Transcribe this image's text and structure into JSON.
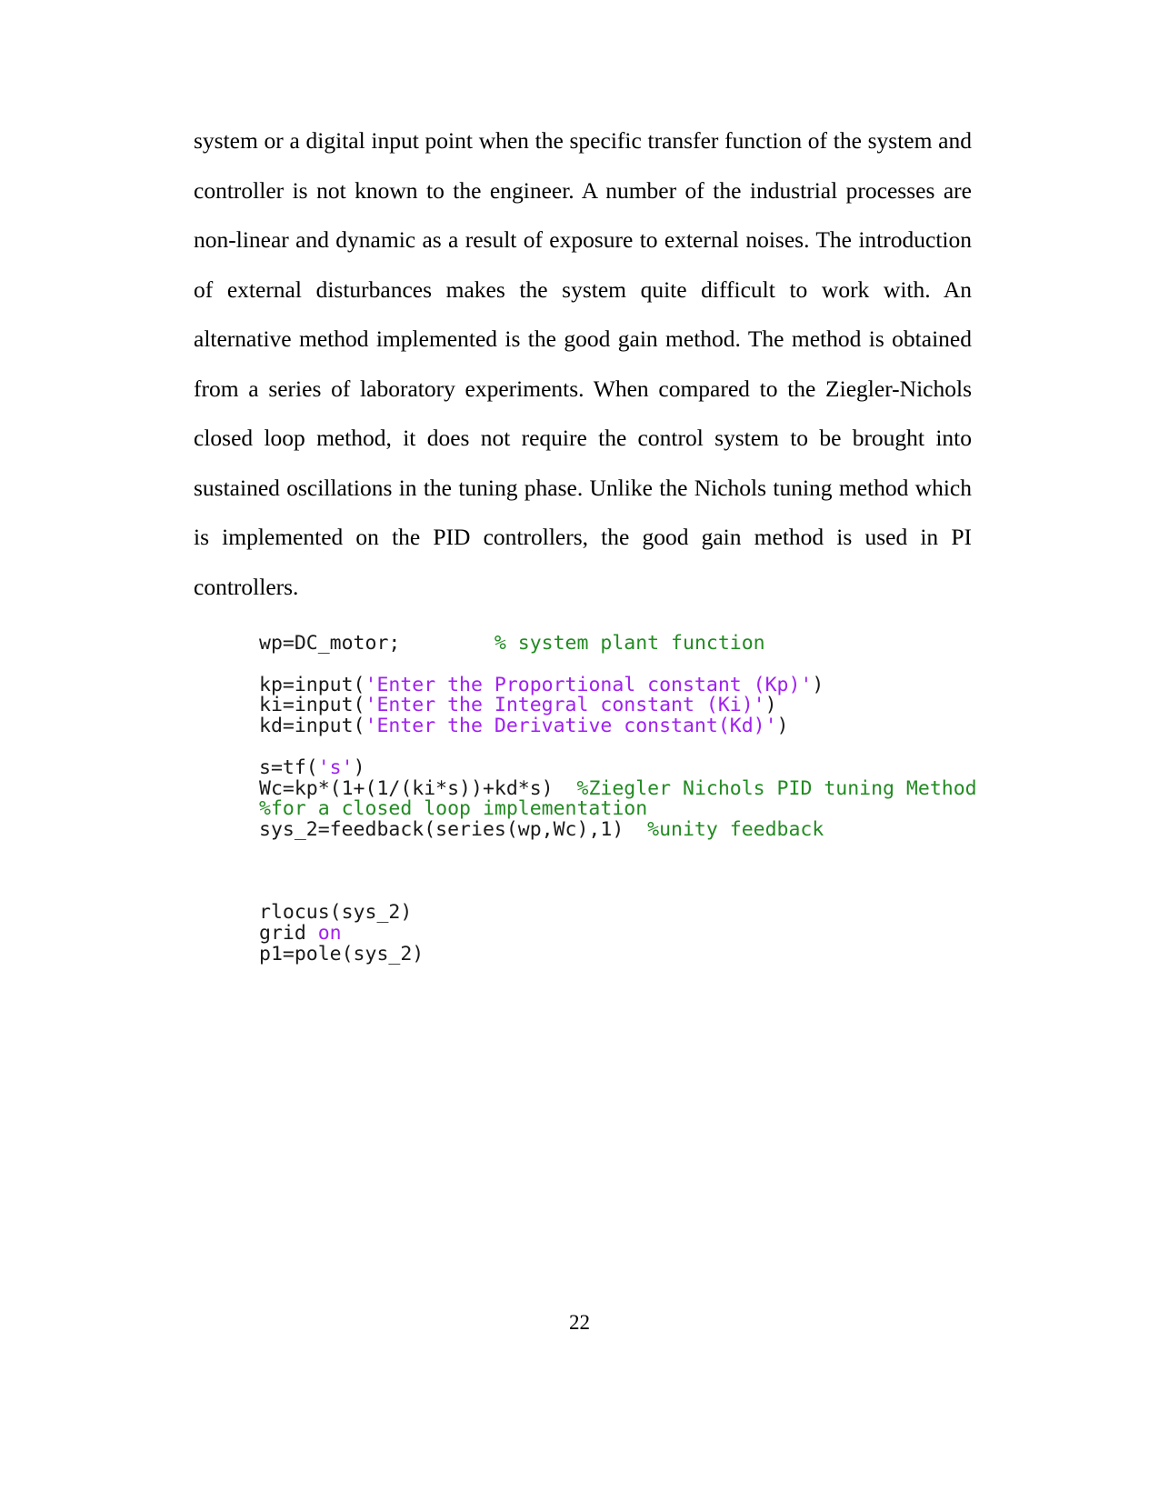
{
  "document": {
    "page_number": "22",
    "paragraph": "system or a digital input point when the specific transfer function of the system and controller is not known to the engineer. A number of the industrial processes are non-linear and dynamic as a result of exposure to external noises. The introduction of external disturbances makes the system quite difficult to work with. An alternative method implemented is the good gain method. The method is obtained from a series of laboratory experiments. When compared to the Ziegler-Nichols closed loop method, it does not require the control system to be brought into sustained oscillations in the tuning phase. Unlike the Nichols tuning method which is implemented on the PID controllers, the good gain method is used in PI controllers."
  },
  "code": {
    "language": "matlab",
    "colors": {
      "plain": "#1a1a1a",
      "string": "#a020f0",
      "comment": "#228b22",
      "keyword": "#a020f0"
    },
    "lines": [
      {
        "id": "line-1",
        "segments": [
          {
            "text": "wp=DC_motor;        ",
            "type": "plain"
          },
          {
            "text": "% system plant function",
            "type": "comment"
          }
        ]
      },
      {
        "id": "line-2",
        "segments": []
      },
      {
        "id": "line-3",
        "segments": [
          {
            "text": "kp=input(",
            "type": "plain"
          },
          {
            "text": "'Enter the Proportional constant (Kp)'",
            "type": "string"
          },
          {
            "text": ")",
            "type": "plain"
          }
        ]
      },
      {
        "id": "line-4",
        "segments": [
          {
            "text": "ki=input(",
            "type": "plain"
          },
          {
            "text": "'Enter the Integral constant (Ki)'",
            "type": "string"
          },
          {
            "text": ")",
            "type": "plain"
          }
        ]
      },
      {
        "id": "line-5",
        "segments": [
          {
            "text": "kd=input(",
            "type": "plain"
          },
          {
            "text": "'Enter the Derivative constant(Kd)'",
            "type": "string"
          },
          {
            "text": ")",
            "type": "plain"
          }
        ]
      },
      {
        "id": "line-6",
        "segments": []
      },
      {
        "id": "line-7",
        "segments": [
          {
            "text": "s=tf(",
            "type": "plain"
          },
          {
            "text": "'s'",
            "type": "string"
          },
          {
            "text": ")",
            "type": "plain"
          }
        ]
      },
      {
        "id": "line-8",
        "segments": [
          {
            "text": "Wc=kp*(1+(1/(ki*s))+kd*s)  ",
            "type": "plain"
          },
          {
            "text": "%Ziegler Nichols PID tuning Method",
            "type": "comment"
          }
        ]
      },
      {
        "id": "line-9",
        "segments": [
          {
            "text": "%for a closed loop implementation",
            "type": "comment"
          }
        ]
      },
      {
        "id": "line-10",
        "segments": [
          {
            "text": "sys_2=feedback(series(wp,Wc),1)  ",
            "type": "plain"
          },
          {
            "text": "%unity feedback",
            "type": "comment"
          }
        ]
      },
      {
        "id": "line-11",
        "segments": []
      },
      {
        "id": "line-12",
        "segments": []
      },
      {
        "id": "line-13",
        "segments": []
      },
      {
        "id": "line-14",
        "segments": [
          {
            "text": "rlocus(sys_2)",
            "type": "plain"
          }
        ]
      },
      {
        "id": "line-15",
        "segments": [
          {
            "text": "grid ",
            "type": "plain"
          },
          {
            "text": "on",
            "type": "keyword"
          }
        ]
      },
      {
        "id": "line-16",
        "segments": [
          {
            "text": "p1=pole(sys_2)",
            "type": "plain"
          }
        ]
      }
    ]
  }
}
